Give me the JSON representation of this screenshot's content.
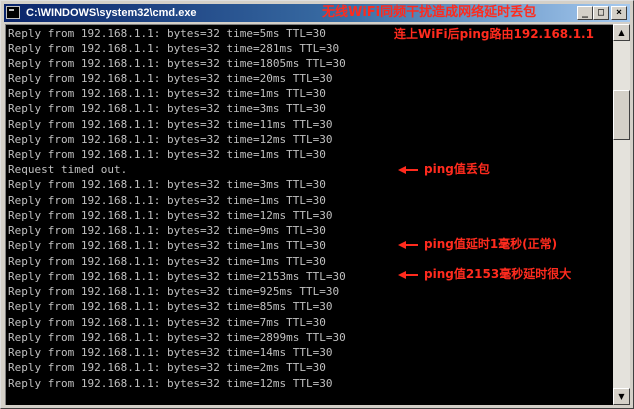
{
  "window": {
    "title": "C:\\WINDOWS\\system32\\cmd.exe",
    "title_annotation": "无线WiFi同频干扰造成网络延时丢包",
    "buttons": {
      "minimize": "_",
      "maximize": "□",
      "close": "×"
    }
  },
  "console": {
    "lines": [
      "Reply from 192.168.1.1: bytes=32 time=5ms TTL=30",
      "Reply from 192.168.1.1: bytes=32 time=281ms TTL=30",
      "Reply from 192.168.1.1: bytes=32 time=1805ms TTL=30",
      "Reply from 192.168.1.1: bytes=32 time=20ms TTL=30",
      "Reply from 192.168.1.1: bytes=32 time=1ms TTL=30",
      "Reply from 192.168.1.1: bytes=32 time=3ms TTL=30",
      "Reply from 192.168.1.1: bytes=32 time=11ms TTL=30",
      "Reply from 192.168.1.1: bytes=32 time=12ms TTL=30",
      "Reply from 192.168.1.1: bytes=32 time=1ms TTL=30",
      "Request timed out.",
      "Reply from 192.168.1.1: bytes=32 time=3ms TTL=30",
      "Reply from 192.168.1.1: bytes=32 time=1ms TTL=30",
      "Reply from 192.168.1.1: bytes=32 time=12ms TTL=30",
      "Reply from 192.168.1.1: bytes=32 time=9ms TTL=30",
      "Reply from 192.168.1.1: bytes=32 time=1ms TTL=30",
      "Reply from 192.168.1.1: bytes=32 time=1ms TTL=30",
      "Reply from 192.168.1.1: bytes=32 time=2153ms TTL=30",
      "Reply from 192.168.1.1: bytes=32 time=925ms TTL=30",
      "Reply from 192.168.1.1: bytes=32 time=85ms TTL=30",
      "Reply from 192.168.1.1: bytes=32 time=7ms TTL=30",
      "Reply from 192.168.1.1: bytes=32 time=2899ms TTL=30",
      "Reply from 192.168.1.1: bytes=32 time=14ms TTL=30",
      "Reply from 192.168.1.1: bytes=32 time=2ms TTL=30",
      "Reply from 192.168.1.1: bytes=32 time=12ms TTL=30"
    ]
  },
  "annotations": {
    "connected": "连上WiFi后ping路由192.168.1.1",
    "packet_loss": "ping值丢包",
    "normal_latency": "ping值延时1毫秒(正常)",
    "high_latency": "ping值2153毫秒延时很大"
  },
  "colors": {
    "annotation": "#ff2b1e",
    "console_text": "#c0c0c0",
    "console_bg": "#000000",
    "titlebar_start": "#0a246a"
  },
  "icons": {
    "app": "console-icon",
    "scroll_up": "arrow-up-icon",
    "scroll_down": "arrow-down-icon"
  }
}
